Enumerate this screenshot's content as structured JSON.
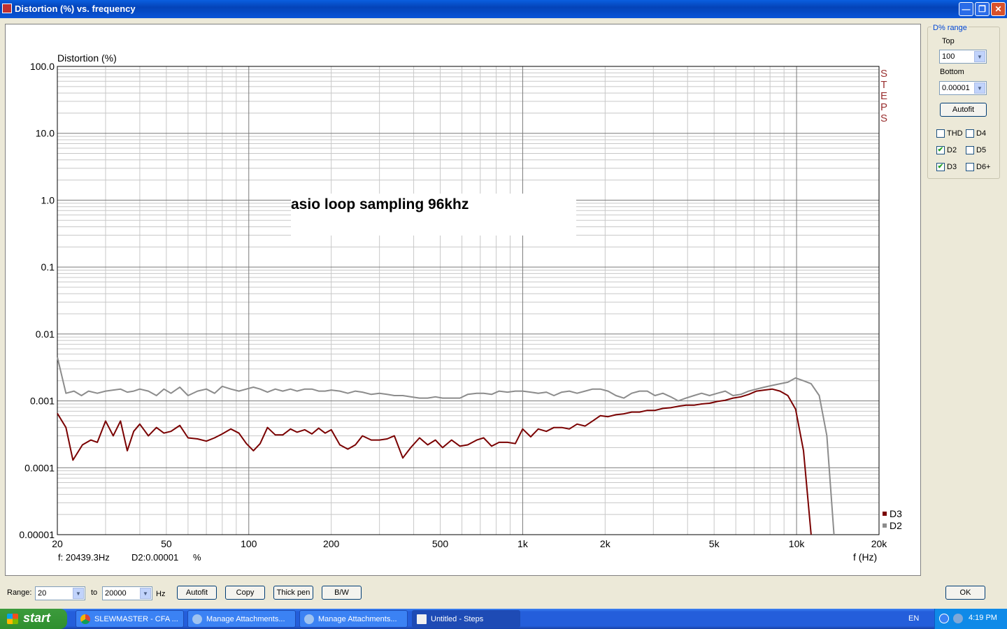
{
  "window": {
    "title": "Distortion (%) vs. frequency"
  },
  "chart_data": {
    "type": "line",
    "ylabel": "Distortion (%)",
    "xlabel": "f (Hz)",
    "annotation": "asio loop sampling 96khz",
    "brand_vertical": "STEPS",
    "xscale": "log",
    "yscale": "log",
    "xlim": [
      20,
      20000
    ],
    "ylim": [
      1e-05,
      100
    ],
    "x_ticks": [
      20,
      50,
      100,
      200,
      500,
      1000,
      2000,
      5000,
      10000,
      20000
    ],
    "x_tick_labels": [
      "20",
      "50",
      "100",
      "200",
      "500",
      "1k",
      "2k",
      "5k",
      "10k",
      "20k"
    ],
    "y_ticks": [
      1e-05,
      0.0001,
      0.001,
      0.01,
      0.1,
      1,
      10,
      100
    ],
    "y_tick_labels": [
      "0.00001",
      "0.0001",
      "0.001",
      "0.01",
      "0.1",
      "1.0",
      "10.0",
      "100.0"
    ],
    "grid": true,
    "legend_position": "bottom-right",
    "series": [
      {
        "name": "D3",
        "color": "#7a0000",
        "points": [
          [
            20,
            0.00065
          ],
          [
            21.5,
            0.0004
          ],
          [
            22.8,
            0.00013
          ],
          [
            24.7,
            0.00022
          ],
          [
            26.5,
            0.00026
          ],
          [
            28,
            0.00024
          ],
          [
            30,
            0.0005
          ],
          [
            32,
            0.0003
          ],
          [
            34,
            0.0005
          ],
          [
            36,
            0.00018
          ],
          [
            38,
            0.00035
          ],
          [
            40,
            0.00045
          ],
          [
            43,
            0.0003
          ],
          [
            46,
            0.0004
          ],
          [
            49,
            0.00033
          ],
          [
            52,
            0.00035
          ],
          [
            56,
            0.00043
          ],
          [
            60,
            0.00028
          ],
          [
            65,
            0.00027
          ],
          [
            70,
            0.00025
          ],
          [
            75,
            0.00028
          ],
          [
            80,
            0.00032
          ],
          [
            86,
            0.00038
          ],
          [
            92,
            0.00033
          ],
          [
            98,
            0.00023
          ],
          [
            104,
            0.00018
          ],
          [
            110,
            0.00023
          ],
          [
            117,
            0.0004
          ],
          [
            125,
            0.00031
          ],
          [
            133,
            0.00031
          ],
          [
            142,
            0.00038
          ],
          [
            150,
            0.00034
          ],
          [
            160,
            0.00037
          ],
          [
            170,
            0.00032
          ],
          [
            180,
            0.00039
          ],
          [
            190,
            0.00033
          ],
          [
            200,
            0.00037
          ],
          [
            215,
            0.00022
          ],
          [
            230,
            0.00019
          ],
          [
            245,
            0.00022
          ],
          [
            260,
            0.0003
          ],
          [
            280,
            0.00026
          ],
          [
            300,
            0.00026
          ],
          [
            320,
            0.00027
          ],
          [
            340,
            0.0003
          ],
          [
            365,
            0.00014
          ],
          [
            390,
            0.0002
          ],
          [
            420,
            0.00028
          ],
          [
            450,
            0.00022
          ],
          [
            480,
            0.00026
          ],
          [
            510,
            0.0002
          ],
          [
            550,
            0.00026
          ],
          [
            590,
            0.00021
          ],
          [
            630,
            0.00022
          ],
          [
            680,
            0.00026
          ],
          [
            720,
            0.00028
          ],
          [
            770,
            0.00021
          ],
          [
            820,
            0.00024
          ],
          [
            880,
            0.00024
          ],
          [
            940,
            0.00023
          ],
          [
            1000,
            0.00038
          ],
          [
            1070,
            0.00029
          ],
          [
            1140,
            0.00038
          ],
          [
            1220,
            0.00035
          ],
          [
            1300,
            0.0004
          ],
          [
            1390,
            0.0004
          ],
          [
            1480,
            0.00038
          ],
          [
            1580,
            0.00045
          ],
          [
            1690,
            0.00042
          ],
          [
            1800,
            0.0005
          ],
          [
            1920,
            0.0006
          ],
          [
            2050,
            0.00058
          ],
          [
            2190,
            0.00062
          ],
          [
            2340,
            0.00064
          ],
          [
            2500,
            0.00068
          ],
          [
            2670,
            0.00068
          ],
          [
            2850,
            0.00072
          ],
          [
            3040,
            0.00072
          ],
          [
            3250,
            0.00077
          ],
          [
            3470,
            0.00079
          ],
          [
            3700,
            0.00083
          ],
          [
            3950,
            0.00086
          ],
          [
            4220,
            0.00086
          ],
          [
            4500,
            0.0009
          ],
          [
            4810,
            0.00092
          ],
          [
            5140,
            0.00098
          ],
          [
            5490,
            0.00102
          ],
          [
            5860,
            0.0011
          ],
          [
            6260,
            0.00115
          ],
          [
            6690,
            0.00125
          ],
          [
            7140,
            0.0014
          ],
          [
            7620,
            0.00145
          ],
          [
            8140,
            0.0015
          ],
          [
            8700,
            0.0014
          ],
          [
            9290,
            0.0012
          ],
          [
            9920,
            0.00075
          ],
          [
            10600,
            0.00018
          ],
          [
            11300,
            1e-05
          ]
        ]
      },
      {
        "name": "D2",
        "color": "#8c8c8c",
        "points": [
          [
            20,
            0.0045
          ],
          [
            21.5,
            0.0013
          ],
          [
            23,
            0.0014
          ],
          [
            24.5,
            0.0012
          ],
          [
            26,
            0.0014
          ],
          [
            28,
            0.0013
          ],
          [
            30,
            0.0014
          ],
          [
            32,
            0.00145
          ],
          [
            34,
            0.0015
          ],
          [
            36,
            0.00135
          ],
          [
            38,
            0.0014
          ],
          [
            40,
            0.0015
          ],
          [
            43,
            0.0014
          ],
          [
            46,
            0.0012
          ],
          [
            49,
            0.0015
          ],
          [
            52,
            0.0013
          ],
          [
            56,
            0.0016
          ],
          [
            60,
            0.0012
          ],
          [
            65,
            0.0014
          ],
          [
            70,
            0.0015
          ],
          [
            75,
            0.0013
          ],
          [
            80,
            0.00165
          ],
          [
            86,
            0.0015
          ],
          [
            92,
            0.0014
          ],
          [
            98,
            0.0015
          ],
          [
            104,
            0.0016
          ],
          [
            110,
            0.0015
          ],
          [
            117,
            0.00135
          ],
          [
            125,
            0.0015
          ],
          [
            133,
            0.0014
          ],
          [
            142,
            0.0015
          ],
          [
            150,
            0.0014
          ],
          [
            160,
            0.0015
          ],
          [
            170,
            0.0015
          ],
          [
            180,
            0.0014
          ],
          [
            190,
            0.0014
          ],
          [
            200,
            0.00145
          ],
          [
            215,
            0.0014
          ],
          [
            230,
            0.0013
          ],
          [
            245,
            0.0014
          ],
          [
            260,
            0.00135
          ],
          [
            280,
            0.00125
          ],
          [
            300,
            0.0013
          ],
          [
            320,
            0.00125
          ],
          [
            340,
            0.0012
          ],
          [
            365,
            0.0012
          ],
          [
            390,
            0.00115
          ],
          [
            420,
            0.0011
          ],
          [
            450,
            0.0011
          ],
          [
            480,
            0.00115
          ],
          [
            510,
            0.0011
          ],
          [
            550,
            0.0011
          ],
          [
            590,
            0.0011
          ],
          [
            630,
            0.00125
          ],
          [
            680,
            0.0013
          ],
          [
            720,
            0.0013
          ],
          [
            770,
            0.00125
          ],
          [
            820,
            0.0014
          ],
          [
            880,
            0.00135
          ],
          [
            940,
            0.0014
          ],
          [
            1000,
            0.0014
          ],
          [
            1070,
            0.00135
          ],
          [
            1140,
            0.0013
          ],
          [
            1220,
            0.00135
          ],
          [
            1300,
            0.0012
          ],
          [
            1390,
            0.00135
          ],
          [
            1480,
            0.0014
          ],
          [
            1580,
            0.0013
          ],
          [
            1690,
            0.0014
          ],
          [
            1800,
            0.0015
          ],
          [
            1920,
            0.0015
          ],
          [
            2050,
            0.0014
          ],
          [
            2190,
            0.0012
          ],
          [
            2340,
            0.0011
          ],
          [
            2500,
            0.0013
          ],
          [
            2670,
            0.0014
          ],
          [
            2850,
            0.0014
          ],
          [
            3040,
            0.0012
          ],
          [
            3250,
            0.0013
          ],
          [
            3470,
            0.00115
          ],
          [
            3700,
            0.001
          ],
          [
            3950,
            0.0011
          ],
          [
            4220,
            0.0012
          ],
          [
            4500,
            0.0013
          ],
          [
            4810,
            0.0012
          ],
          [
            5140,
            0.0013
          ],
          [
            5490,
            0.0014
          ],
          [
            5860,
            0.0012
          ],
          [
            6260,
            0.00125
          ],
          [
            6690,
            0.0014
          ],
          [
            7140,
            0.0015
          ],
          [
            7620,
            0.0016
          ],
          [
            8140,
            0.0017
          ],
          [
            8700,
            0.0018
          ],
          [
            9290,
            0.0019
          ],
          [
            9920,
            0.0022
          ],
          [
            10600,
            0.002
          ],
          [
            11300,
            0.0018
          ],
          [
            12100,
            0.0012
          ],
          [
            12900,
            0.0003
          ],
          [
            13700,
            1e-05
          ]
        ]
      }
    ]
  },
  "readout": {
    "frequency": "f: 20439.3Hz",
    "value": "D2:0.00001",
    "unit": "%"
  },
  "side_panel": {
    "group_label": "D% range",
    "top_label": "Top",
    "top_value": "100",
    "bottom_label": "Bottom",
    "bottom_value": "0.00001",
    "autofit_label": "Autofit",
    "checkboxes": [
      {
        "label": "THD",
        "checked": false
      },
      {
        "label": "D4",
        "checked": false
      },
      {
        "label": "D2",
        "checked": true
      },
      {
        "label": "D5",
        "checked": false
      },
      {
        "label": "D3",
        "checked": true
      },
      {
        "label": "D6+",
        "checked": false
      }
    ]
  },
  "bottom_bar": {
    "range_label": "Range:",
    "range_from": "20",
    "to_label": "to",
    "range_to": "20000",
    "unit_label": "Hz",
    "autofit_label": "Autofit",
    "copy_label": "Copy",
    "thick_pen_label": "Thick pen",
    "bw_label": "B/W",
    "ok_label": "OK"
  },
  "taskbar": {
    "start_label": "start",
    "tasks": [
      {
        "label": "SLEWMASTER - CFA ...",
        "active": false
      },
      {
        "label": "Manage Attachments...",
        "active": false
      },
      {
        "label": "Manage Attachments...",
        "active": false
      },
      {
        "label": "Untitled - Steps",
        "active": true
      }
    ],
    "language": "EN",
    "clock": "4:19 PM"
  }
}
